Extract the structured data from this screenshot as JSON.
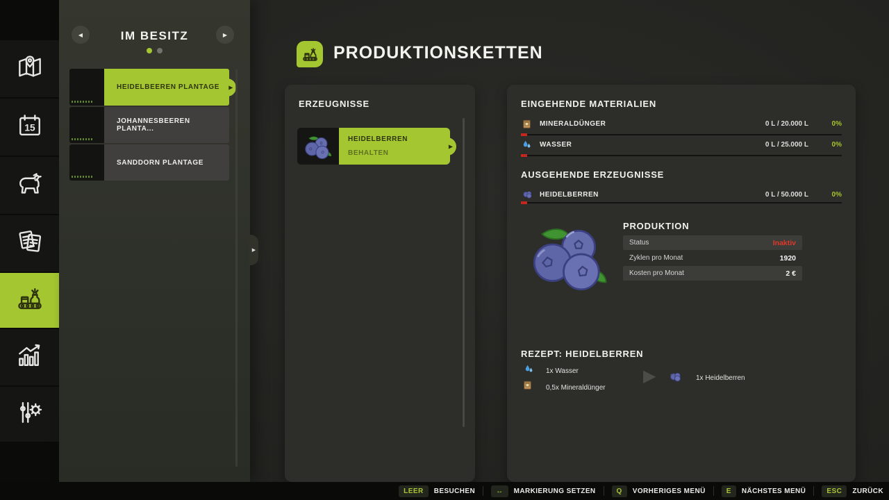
{
  "colors": {
    "accent_green": "#a4c731",
    "status_inactive_red": "#e0382a",
    "percent_green": "#a6c52f",
    "bar_marker_red": "#c4281c"
  },
  "sidebar": {
    "calendar_day": "15",
    "tabs": [
      "map",
      "calendar",
      "animals",
      "contracts",
      "production",
      "statistics",
      "settings"
    ],
    "active_tab": "production"
  },
  "ownership": {
    "title": "IM BESITZ",
    "items": [
      {
        "label": "HEIDELBEEREN PLANTAGE",
        "selected": true
      },
      {
        "label": "JOHANNESBEEREN PLANTA...",
        "selected": false
      },
      {
        "label": "SANDDORN PLANTAGE",
        "selected": false
      }
    ]
  },
  "header": {
    "title": "PRODUKTIONSKETTEN"
  },
  "products": {
    "title": "ERZEUGNISSE",
    "items": [
      {
        "name": "HEIDELBERREN",
        "mode": "BEHALTEN",
        "icon": "blueberry-icon"
      }
    ]
  },
  "details": {
    "inputs_title": "EINGEHENDE MATERIALIEN",
    "inputs": [
      {
        "icon": "fertilizer-icon",
        "label": "MINERALDÜNGER",
        "amount": "0 L / 20.000 L",
        "percent": "0%"
      },
      {
        "icon": "water-icon",
        "label": "WASSER",
        "amount": "0 L / 25.000 L",
        "percent": "0%"
      }
    ],
    "outputs_title": "AUSGEHENDE ERZEUGNISSE",
    "outputs": [
      {
        "icon": "blueberry-icon",
        "label": "HEIDELBERREN",
        "amount": "0 L / 50.000 L",
        "percent": "0%"
      }
    ],
    "production": {
      "title": "PRODUKTION",
      "rows": [
        {
          "label": "Status",
          "value": "Inaktiv"
        },
        {
          "label": "Zyklen pro Monat",
          "value": "1920"
        },
        {
          "label": "Kosten pro Monat",
          "value": "2 €"
        }
      ]
    },
    "recipe": {
      "title": "REZEPT: HEIDELBERREN",
      "ingredients": [
        {
          "icon": "water-icon",
          "label": "1x Wasser"
        },
        {
          "icon": "fertilizer-icon",
          "label": "0,5x Mineraldünger"
        }
      ],
      "result": {
        "icon": "blueberry-icon",
        "label": "1x Heidelberren"
      }
    }
  },
  "bottom_bar": {
    "hints": [
      {
        "key": "LEER",
        "label": "BESUCHEN"
      },
      {
        "key": "↔",
        "label": "MARKIERUNG SETZEN"
      },
      {
        "key": "Q",
        "label": "VORHERIGES MENÜ"
      },
      {
        "key": "E",
        "label": "NÄCHSTES MENÜ"
      },
      {
        "key": "ESC",
        "label": "ZURÜCK"
      }
    ]
  }
}
